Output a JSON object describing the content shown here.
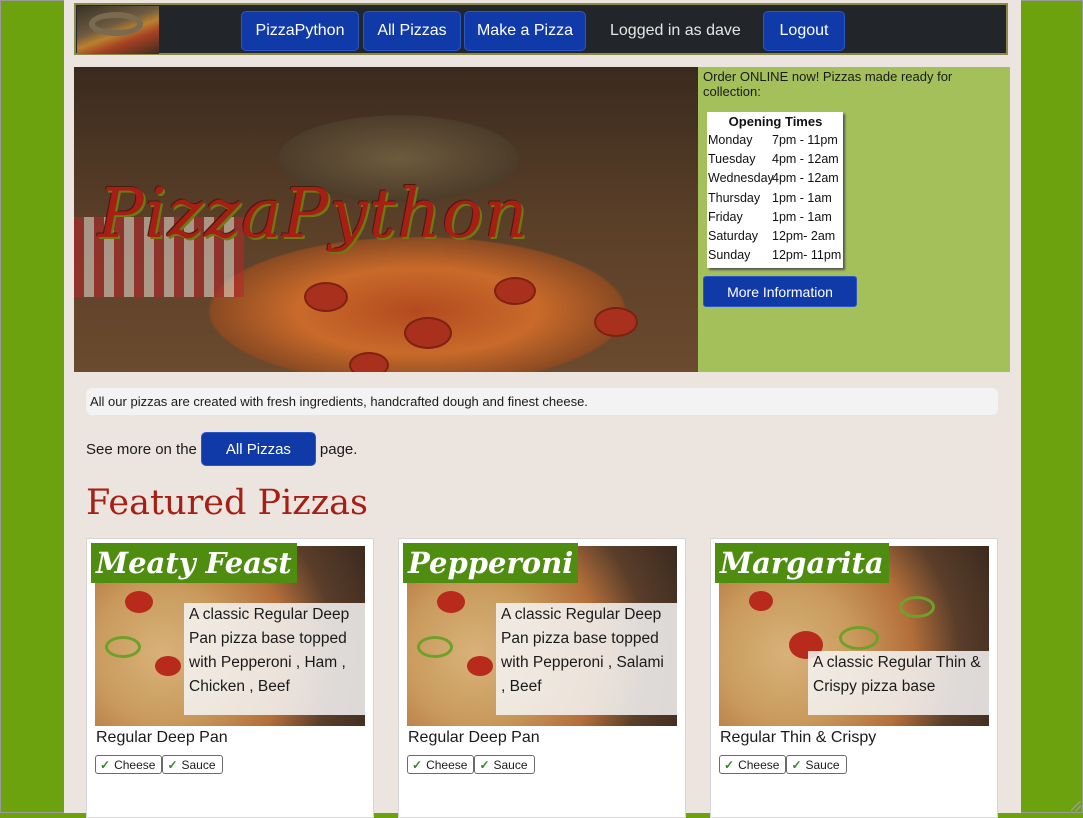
{
  "nav": {
    "brand": "PizzaPython",
    "all_pizzas": "All Pizzas",
    "make_pizza": "Make a Pizza",
    "user_status": "Logged in as dave",
    "logout": "Logout"
  },
  "hero": {
    "title": "PizzaPython",
    "tagline": "Order ONLINE now! Pizzas made ready for collection:",
    "hours_title": "Opening Times",
    "hours": [
      {
        "day": "Monday",
        "time": "7pm  - 11pm"
      },
      {
        "day": "Tuesday",
        "time": "4pm  - 12am"
      },
      {
        "day": "Wednesday",
        "time": "4pm  - 12am"
      },
      {
        "day": "Thursday",
        "time": "1pm  - 1am"
      },
      {
        "day": "Friday",
        "time": "1pm  - 1am"
      },
      {
        "day": "Saturday",
        "time": "12pm- 2am"
      },
      {
        "day": "Sunday",
        "time": "12pm- 11pm"
      }
    ],
    "more_info": "More Information"
  },
  "intro": "All our pizzas are created with fresh ingredients, handcrafted dough and finest cheese.",
  "see_more": {
    "prefix": "See more on the",
    "button": "All Pizzas",
    "suffix": "page."
  },
  "featured_title": "Featured Pizzas",
  "pizzas": [
    {
      "name": "Meaty Feast",
      "description": "A classic Regular Deep Pan pizza base topped with Pepperoni , Ham , Chicken , Beef",
      "base": "Regular Deep Pan",
      "toppings": [
        "Cheese",
        "Sauce"
      ]
    },
    {
      "name": "Pepperoni",
      "description": "A classic Regular Deep Pan pizza base topped with Pepperoni , Salami , Beef",
      "base": "Regular Deep Pan",
      "toppings": [
        "Cheese",
        "Sauce"
      ]
    },
    {
      "name": "Margarita",
      "description": "A classic Regular Thin & Crispy pizza base",
      "base": "Regular Thin & Crispy",
      "toppings": [
        "Cheese",
        "Sauce"
      ]
    }
  ],
  "colors": {
    "page_bg": "#6da20f",
    "content_bg": "#ece4de",
    "button": "#0f3aa8",
    "accent_red": "#a51f14",
    "name_badge": "#4f8d10",
    "side_panel": "#a4c05b"
  }
}
